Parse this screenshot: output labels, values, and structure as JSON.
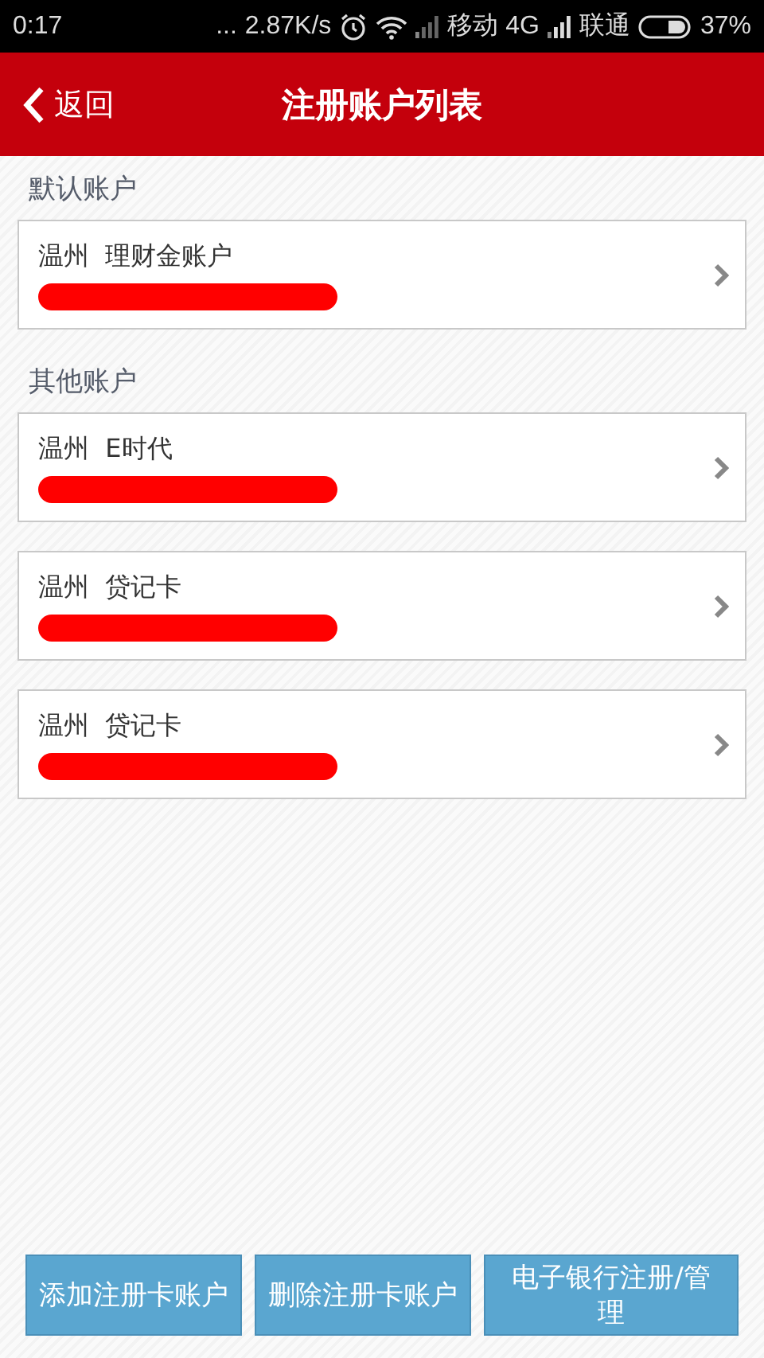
{
  "status_bar": {
    "time": "0:17",
    "more": "...",
    "speed": "2.87K/s",
    "carrier_1": "移动 4G",
    "carrier_2": "联通",
    "battery": "37%"
  },
  "header": {
    "back": "返回",
    "title": "注册账户列表"
  },
  "sections": [
    {
      "label": "默认账户",
      "accounts": [
        {
          "name": "温州  理财金账户"
        }
      ]
    },
    {
      "label": "其他账户",
      "accounts": [
        {
          "name": "温州  E时代"
        },
        {
          "name": "温州  贷记卡"
        },
        {
          "name": "温州  贷记卡"
        }
      ]
    }
  ],
  "buttons": [
    "添加注册卡账户",
    "删除注册卡账户",
    "电子银行注册/管理"
  ]
}
